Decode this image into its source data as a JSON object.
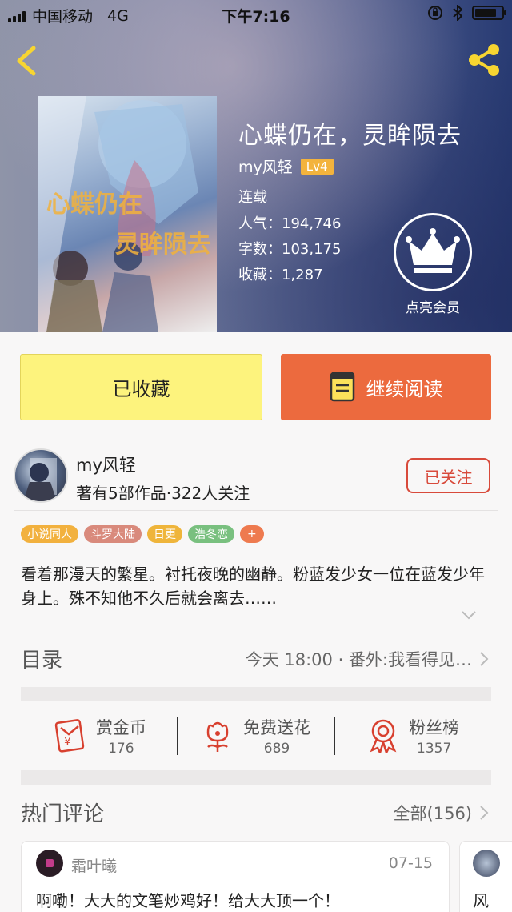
{
  "status_bar": {
    "carrier": "中国移动",
    "network": "4G",
    "time": "下午7:16"
  },
  "book": {
    "title": "心蝶仍在，灵眸陨去",
    "cover_text_line1": "心蝶仍在",
    "cover_text_line2": "灵眸陨去",
    "author": "my风轻",
    "level": "Lv4",
    "status": "连载",
    "popularity": "人气：194,746",
    "word_count": "字数：103,175",
    "favorites": "收藏：1,287"
  },
  "member": {
    "label": "点亮会员"
  },
  "actions": {
    "favorite_label": "已收藏",
    "read_label": "继续阅读"
  },
  "author_info": {
    "name": "my风轻",
    "stats": "著有5部作品·322人关注",
    "follow_label": "已关注"
  },
  "tags": [
    {
      "label": "小说同人",
      "color": "#f2b13e"
    },
    {
      "label": "斗罗大陆",
      "color": "#d98a7c"
    },
    {
      "label": "日更",
      "color": "#efb53b"
    },
    {
      "label": "浩冬恋",
      "color": "#79c07f"
    },
    {
      "label": "+",
      "color": "#ee7a4f"
    }
  ],
  "synopsis": "看着那漫天的繁星。衬托夜晚的幽静。粉蓝发少女一位在蓝发少年身上。殊不知他不久后就会离去……",
  "toc": {
    "label": "目录",
    "latest": "今天 18:00 · 番外:我看得见…"
  },
  "stats": [
    {
      "label": "赏金币",
      "value": "176",
      "icon": "red-envelope-icon"
    },
    {
      "label": "免费送花",
      "value": "689",
      "icon": "flower-icon"
    },
    {
      "label": "粉丝榜",
      "value": "1357",
      "icon": "medal-icon"
    }
  ],
  "comments_section": {
    "title": "热门评论",
    "all_label": "全部(156)"
  },
  "comments": [
    {
      "user": "霜叶曦",
      "date": "07-15",
      "text": "啊嘞！大大的文笔炒鸡好！给大大顶一个！"
    },
    {
      "user": "",
      "date": "",
      "text": "风"
    }
  ],
  "colors": {
    "accent_orange": "#ec6a3e",
    "favorite_yellow": "#fdf37d",
    "follow_red": "#d84a3b",
    "level_badge": "#f3b33d"
  }
}
